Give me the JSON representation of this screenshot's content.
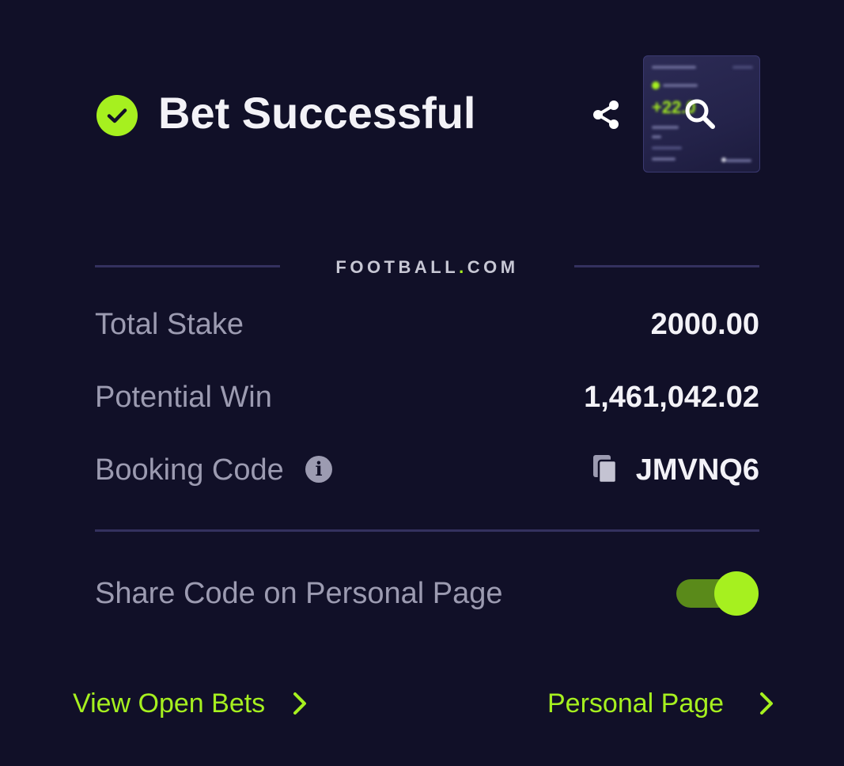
{
  "header": {
    "title": "Bet Successful",
    "status_icon": "check-circle-icon",
    "share_icon": "share-icon",
    "preview_icon": "zoom-icon"
  },
  "brand": {
    "name_part1": "FOOTBALL",
    "dot": ".",
    "name_part2": "COM"
  },
  "details": {
    "total_stake_label": "Total Stake",
    "total_stake_value": "2000.00",
    "potential_win_label": "Potential Win",
    "potential_win_value": "1,461,042.02",
    "booking_code_label": "Booking Code",
    "booking_code_info": "i",
    "booking_code_value": "JMVNQ6"
  },
  "share_toggle": {
    "label": "Share Code on Personal Page",
    "enabled": true
  },
  "footer": {
    "open_bets_label": "View Open Bets",
    "personal_page_label": "Personal Page"
  },
  "colors": {
    "background": "#111028",
    "accent": "#a6f01f",
    "muted_text": "#9c9bb1",
    "divider": "#34315f"
  }
}
